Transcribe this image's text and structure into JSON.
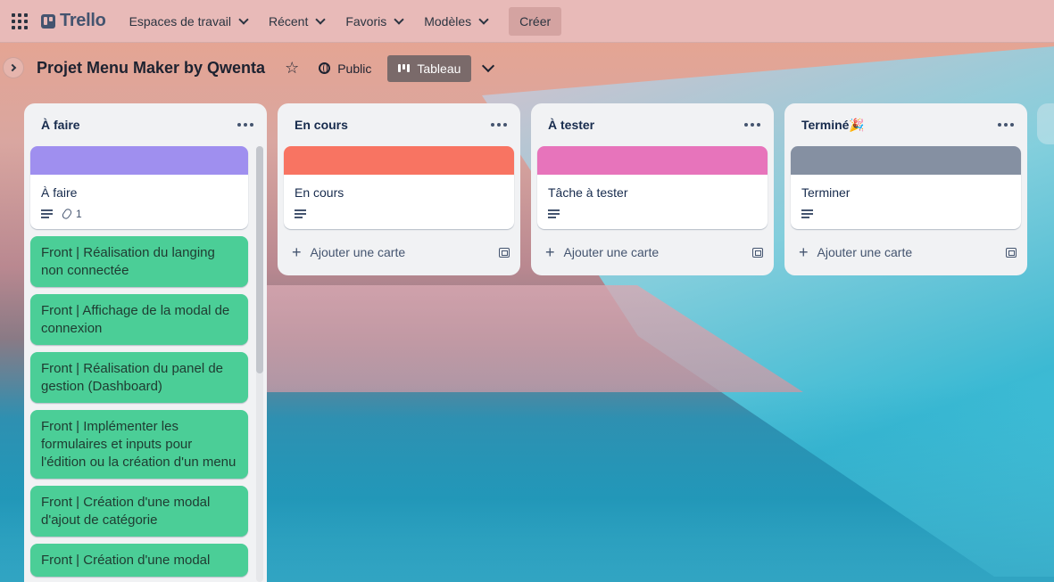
{
  "header": {
    "app_name": "Trello",
    "nav": [
      {
        "label": "Espaces de travail"
      },
      {
        "label": "Récent"
      },
      {
        "label": "Favoris"
      },
      {
        "label": "Modèles"
      }
    ],
    "create_label": "Créer"
  },
  "board": {
    "title": "Projet Menu Maker by Qwenta",
    "visibility": "Public",
    "view_label": "Tableau"
  },
  "lists": [
    {
      "title": "À faire",
      "cover_card": {
        "cover_color": "#9f8fef",
        "title": "À faire",
        "attachments": "1"
      },
      "cards": [
        "Front | Réalisation du langing non connectée",
        "Front | Affichage de la modal de connexion",
        "Front | Réalisation du panel de gestion (Dashboard)",
        "Front | Implémenter les formulaires et inputs pour l'édition ou la création d'un menu",
        "Front | Création d'une modal d'ajout de catégorie",
        "Front | Création d'une modal"
      ]
    },
    {
      "title": "En cours",
      "cover_card": {
        "cover_color": "#f87462",
        "title": "En cours"
      },
      "add_label": "Ajouter une carte"
    },
    {
      "title": "À tester",
      "cover_card": {
        "cover_color": "#e774bb",
        "title": "Tâche à tester"
      },
      "add_label": "Ajouter une carte"
    },
    {
      "title": "Terminé🎉",
      "cover_card": {
        "cover_color": "#8590a2",
        "title": "Terminer"
      },
      "add_label": "Ajouter une carte"
    }
  ],
  "colors": {
    "header_bg": "#e8bab8",
    "list_bg": "#f1f2f4",
    "green_card": "#4bce97"
  }
}
